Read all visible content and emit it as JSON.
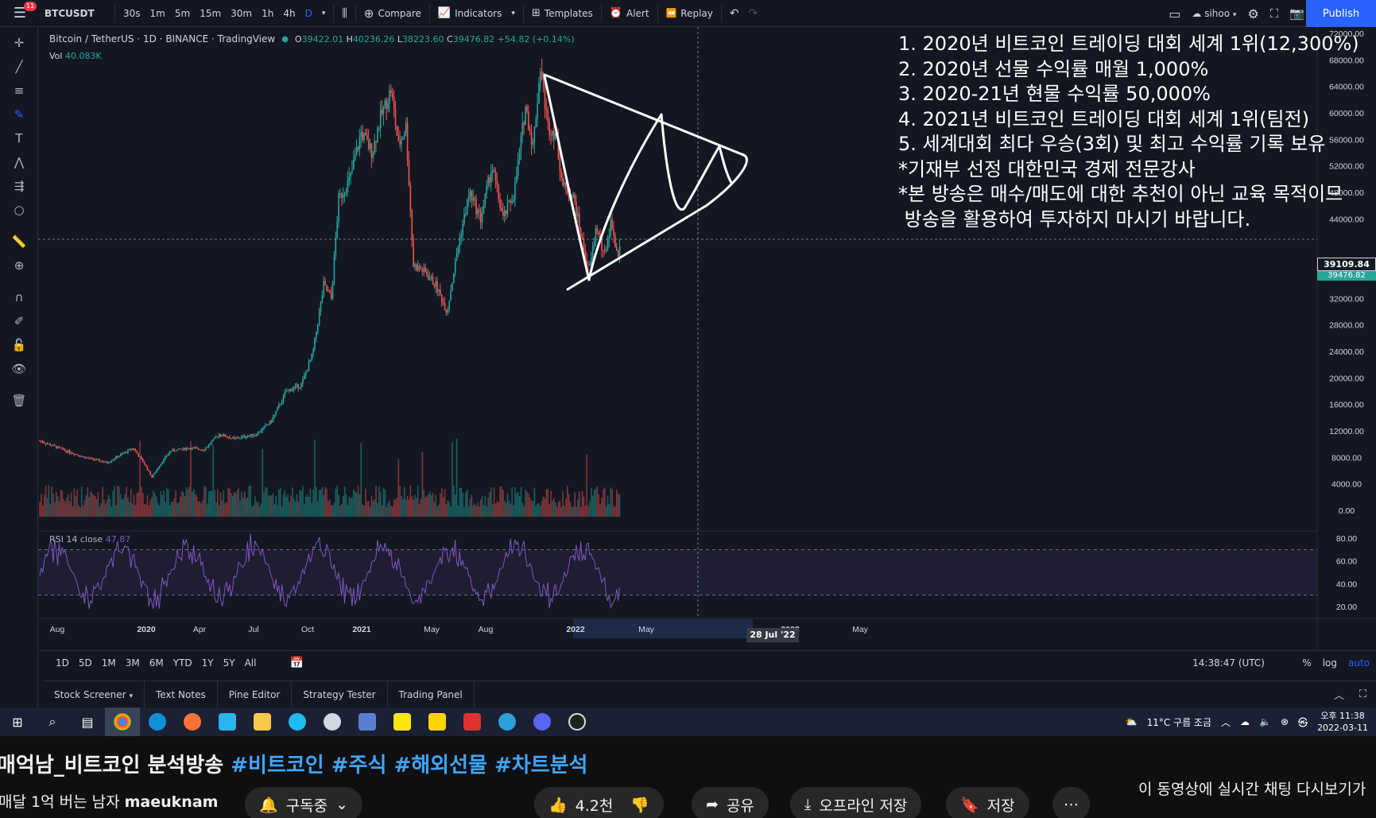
{
  "topbar": {
    "badge": "11",
    "symbol": "BTCUSDT",
    "intervals": [
      "30s",
      "1m",
      "5m",
      "15m",
      "30m",
      "1h",
      "4h",
      "D"
    ],
    "compare": "Compare",
    "indicators": "Indicators",
    "templates": "Templates",
    "alert": "Alert",
    "replay": "Replay",
    "user": "sihoo",
    "publish": "Publish"
  },
  "legend": {
    "title": "Bitcoin / TetherUS",
    "interval": "1D",
    "exchange": "BINANCE",
    "source": "TradingView",
    "open": "39422.01",
    "high": "40236.26",
    "low": "38223.60",
    "close": "39476.82",
    "change": "+54.82 (+0.14%)",
    "vol_label": "Vol",
    "vol_value": "40.083K",
    "rsi_label": "RSI 14 close",
    "rsi_value": "47.87"
  },
  "overlay": [
    "1. 2020년 비트코인 트레이딩 대회 세계 1위(12,300%)",
    "2. 2020년 선물 수익률 매월 1,000%",
    "3. 2020-21년 현물 수익률 50,000%",
    "4. 2021년 비트코인 트레이딩 대회 세계 1위(팀전)",
    "5. 세계대회 최다 우승(3회) 및 최고 수익률 기록 보유",
    "*기재부 선정 대한민국 경제 전문강사",
    "*본 방송은 매수/매도에 대한 추천이 아닌 교육 목적이므",
    " 방송을 활용하여 투자하지 마시기 바랍니다."
  ],
  "price_axis": {
    "labels": [
      "72000.00",
      "68000.00",
      "64000.00",
      "60000.00",
      "56000.00",
      "52000.00",
      "48000.00",
      "44000.00",
      "36000.00",
      "32000.00",
      "28000.00",
      "24000.00",
      "20000.00",
      "16000.00",
      "12000.00",
      "8000.00",
      "4000.00",
      "0.00"
    ],
    "rsi_labels": [
      "80.00",
      "60.00",
      "40.00",
      "20.00"
    ],
    "current": "39109.84",
    "last": "39476.82"
  },
  "time_axis": {
    "labels": [
      "Aug",
      "2020",
      "Apr",
      "Jul",
      "Oct",
      "2021",
      "May",
      "Aug",
      "2022",
      "May",
      "2023",
      "May"
    ],
    "highlight": "28 Jul '22"
  },
  "range_bar": {
    "ranges": [
      "1D",
      "5D",
      "1M",
      "3M",
      "6M",
      "YTD",
      "1Y",
      "5Y",
      "All"
    ],
    "clock": "14:38:47 (UTC)",
    "percent": "%",
    "log": "log",
    "auto": "auto"
  },
  "bottom_tabs": [
    "Stock Screener",
    "Text Notes",
    "Pine Editor",
    "Strategy Tester",
    "Trading Panel"
  ],
  "taskbar": {
    "weather": "11°C 구름 조금",
    "time": "오후 11:38",
    "date": "2022-03-11"
  },
  "youtube": {
    "title_main": "매억남_비트코인 분석방송",
    "title_tags": "#비트코인 #주식 #해외선물 #차트분석",
    "channel_prefix": "매달 1억 버는 남자",
    "channel_name": "maeuknam",
    "subscribe": "구독중",
    "likes": "4.2천",
    "share": "공유",
    "offline": "오프라인 저장",
    "save": "저장",
    "chat": "이 동영상에 실시간 채팅 다시보기가"
  },
  "colors": {
    "up": "#26a69a",
    "down": "#ef5350",
    "rsi": "#7e57c2",
    "accent": "#2962ff",
    "bg": "#131722"
  }
}
